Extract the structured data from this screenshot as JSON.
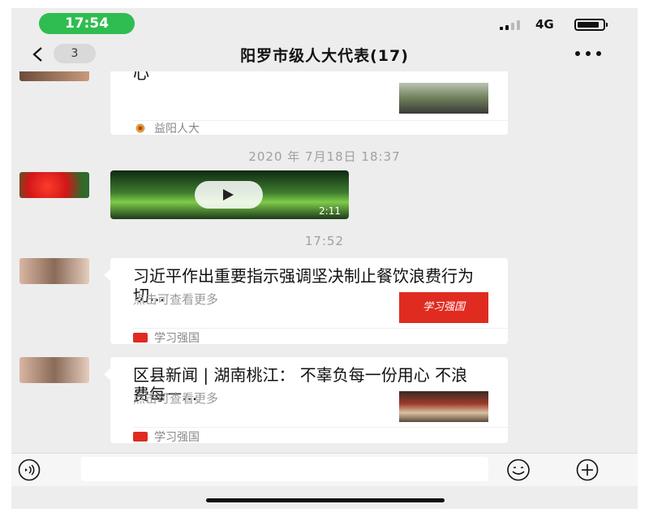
{
  "status_bar": {
    "time": "17:54",
    "network": "4G",
    "battery_percent": 85
  },
  "nav": {
    "unread_count": "3",
    "title": "阳罗市级人大代表(17)"
  },
  "messages": [
    {
      "type": "link-card",
      "title": "心",
      "source": "益阳人大"
    },
    {
      "type": "timestamp",
      "text": "2020 年 7月18日  18:37"
    },
    {
      "type": "video",
      "duration": "2:11"
    },
    {
      "type": "timestamp",
      "text": "17:52"
    },
    {
      "type": "link-card",
      "title": "习近平作出重要指示强调坚决制止餐饮浪费行为切...",
      "desc": "点击可查看更多",
      "source": "学习强国",
      "thumb_text": "学习强国"
    },
    {
      "type": "link-card",
      "title": "区县新闻 | 湖南桃江： 不辜负每一份用心 不浪费每一...",
      "desc": "点击可查看更多",
      "source": "学习强国"
    }
  ],
  "input_bar": {
    "placeholder": ""
  },
  "colors": {
    "wechat_green": "#2fbd51",
    "chat_bg": "#ededed",
    "xuexi_red": "#e02b20"
  },
  "icons": [
    "back-icon",
    "more-icon",
    "play-icon",
    "voice-icon",
    "emoji-icon",
    "plus-icon",
    "xuexi-icon",
    "yiyang-icon"
  ]
}
